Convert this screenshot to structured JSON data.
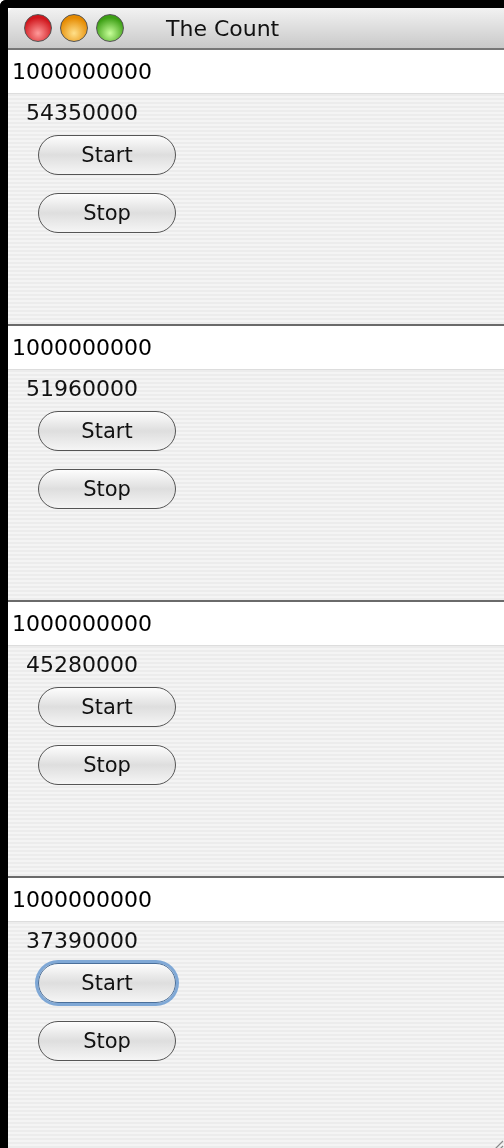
{
  "window": {
    "title": "The Count"
  },
  "counters": [
    {
      "value": "1000000000",
      "count": "54350000",
      "buttons": [
        {
          "label": "Start",
          "focused": false
        },
        {
          "label": "Stop",
          "focused": false
        }
      ]
    },
    {
      "value": "1000000000",
      "count": "51960000",
      "buttons": [
        {
          "label": "Start",
          "focused": false
        },
        {
          "label": "Stop",
          "focused": false
        }
      ]
    },
    {
      "value": "1000000000",
      "count": "45280000",
      "buttons": [
        {
          "label": "Start",
          "focused": false
        },
        {
          "label": "Stop",
          "focused": false
        }
      ]
    },
    {
      "value": "1000000000",
      "count": "37390000",
      "buttons": [
        {
          "label": "Start",
          "focused": true
        },
        {
          "label": "Stop",
          "focused": false
        }
      ]
    }
  ]
}
